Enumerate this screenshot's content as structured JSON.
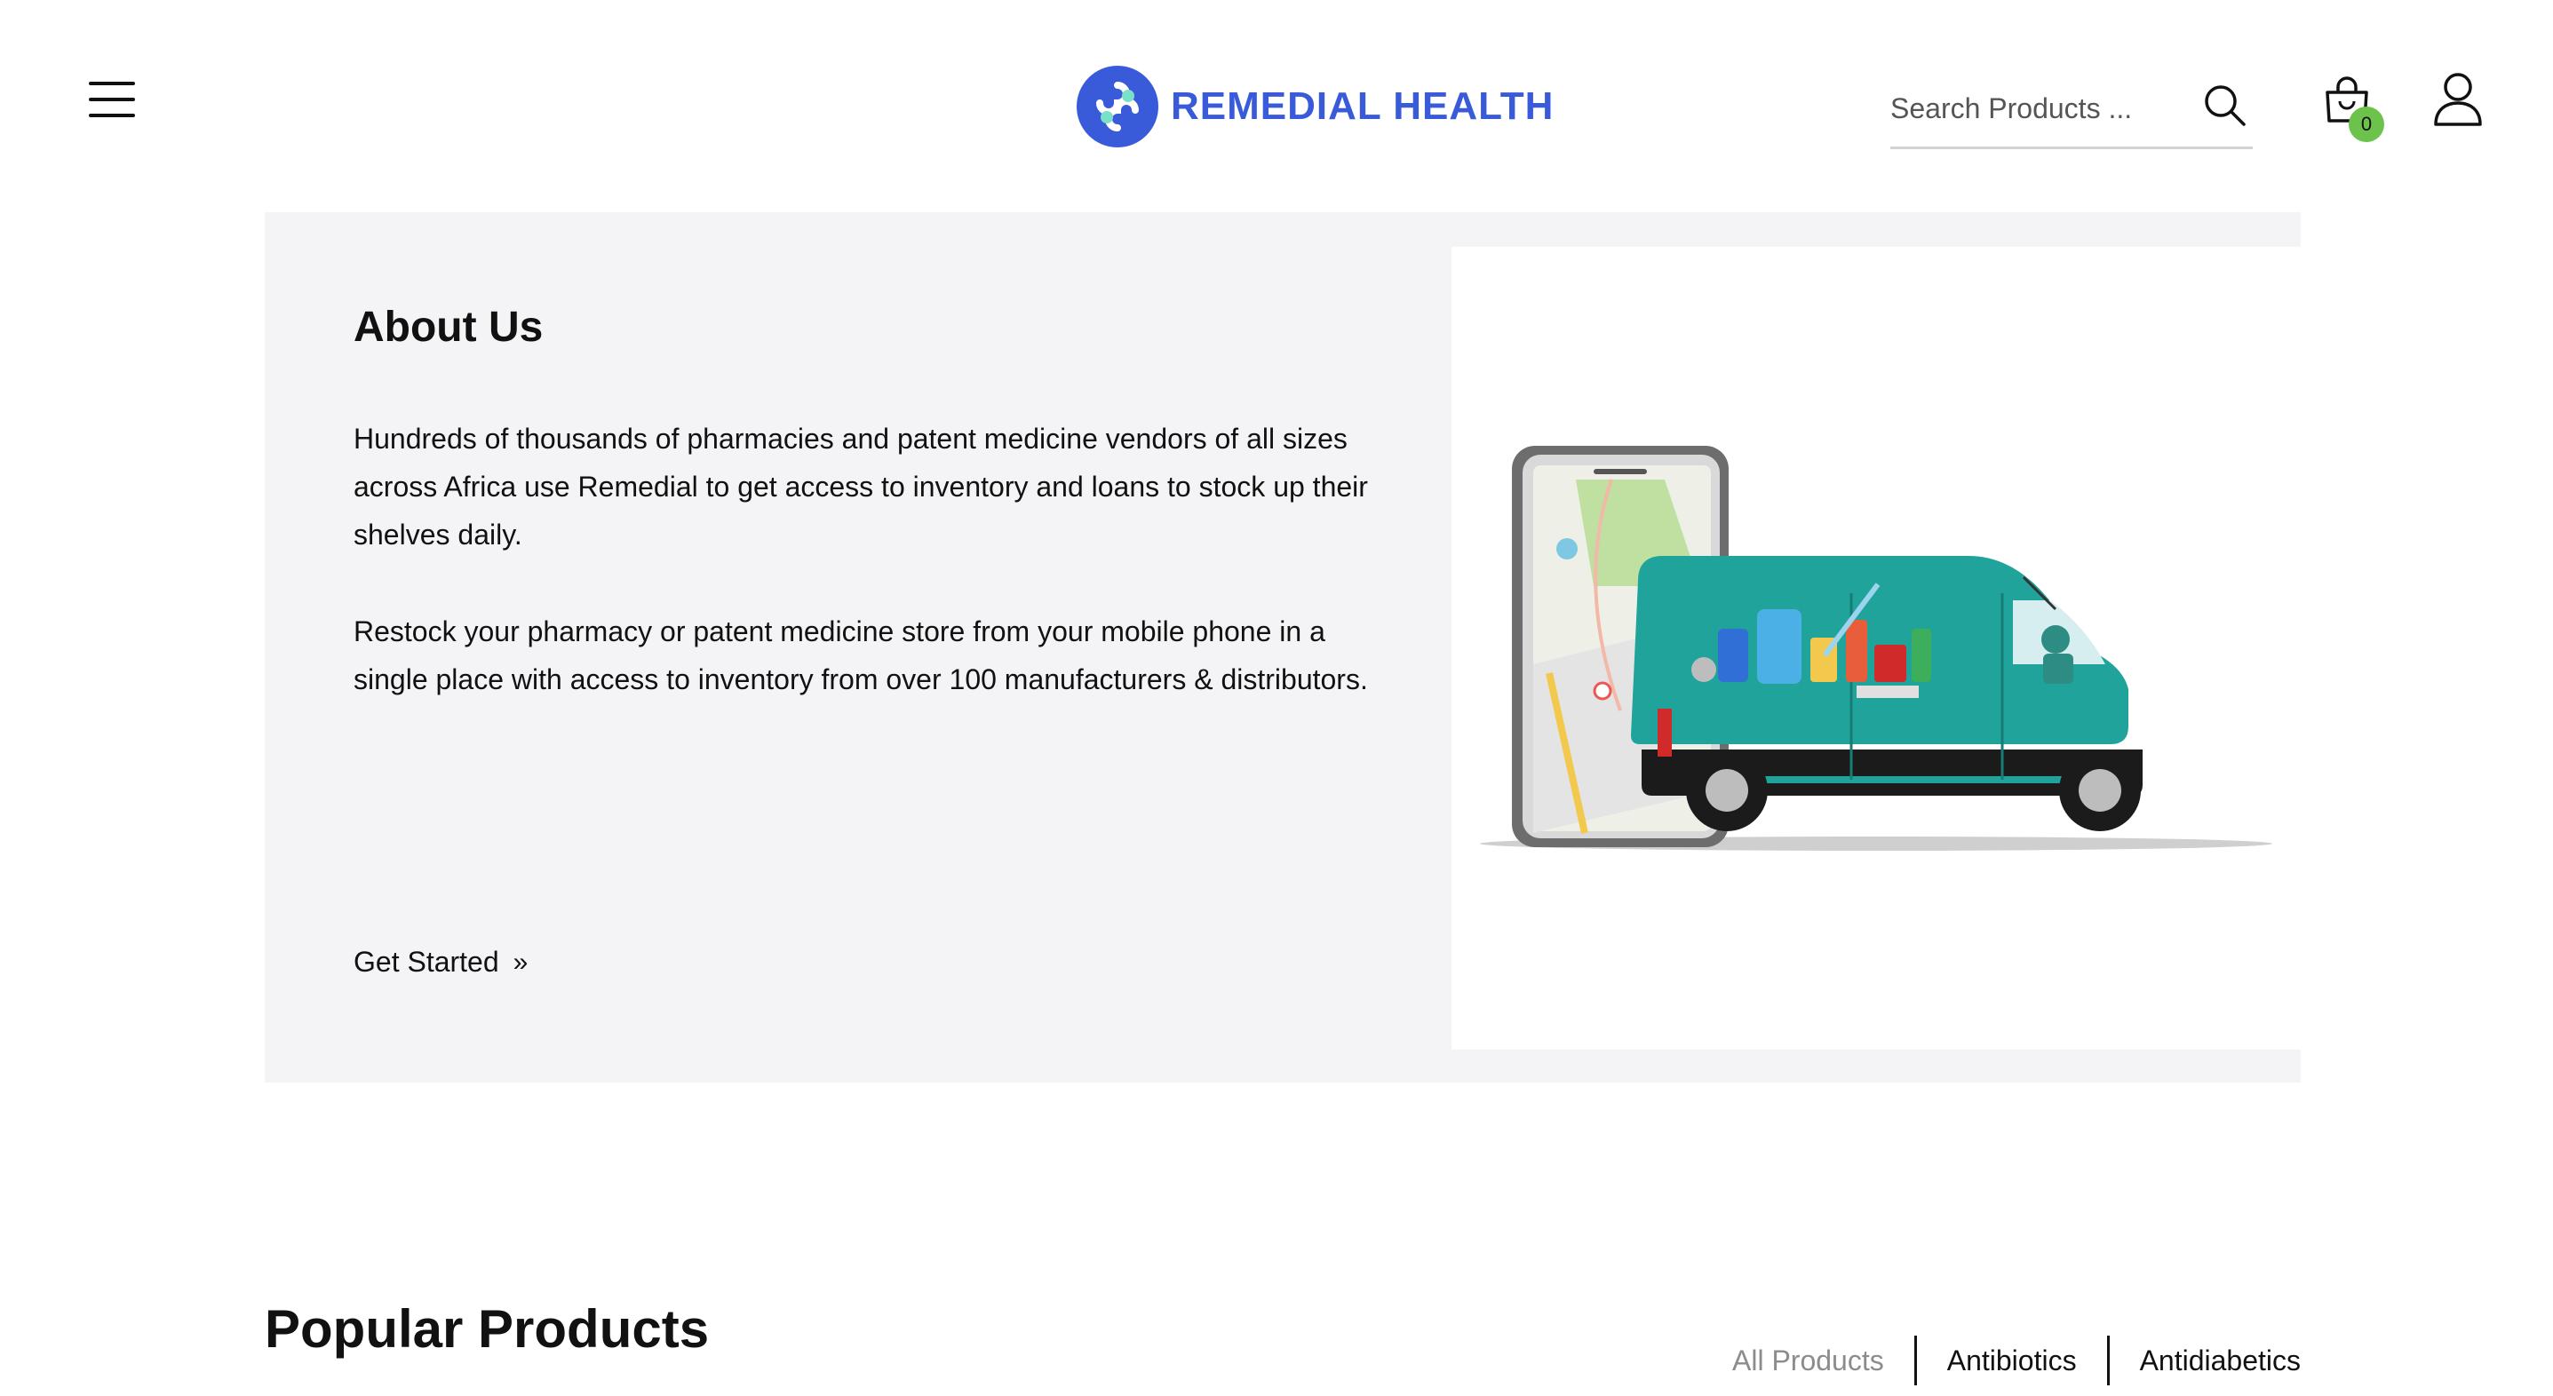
{
  "header": {
    "logo_text": "REMEDIAL HEALTH",
    "search": {
      "placeholder": "Search Products ...",
      "value": ""
    },
    "cart_count": "0",
    "icons": [
      "menu-icon",
      "logo-icon",
      "search-icon",
      "cart-icon",
      "user-icon"
    ]
  },
  "about": {
    "title": "About Us",
    "paragraph1": "Hundreds of thousands of pharmacies and patent medicine vendors of all sizes across Africa use Remedial to get access to inventory and loans to stock up their shelves daily.",
    "paragraph2": "Restock your pharmacy or patent medicine store from your mobile phone in a single place with access to inventory from over 100 manufacturers & distributors.",
    "cta": "Get Started",
    "cta_icon": "»"
  },
  "popular": {
    "title": "Popular Products",
    "filters": [
      "All Products",
      "Antibiotics",
      "Antidiabetics"
    ]
  },
  "colors": {
    "brand_blue": "#3a5bd9",
    "badge_green": "#6cc24a",
    "section_bg": "#f4f4f6",
    "van_teal": "#1fa39a"
  }
}
